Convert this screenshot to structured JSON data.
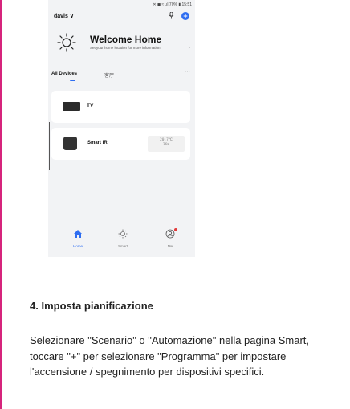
{
  "statusbar": {
    "indicators": "✕ ◼ ≈ .ıl 70% ▮ 15:51"
  },
  "topbar": {
    "home_name": "davis ∨",
    "mic_icon": "microphone-icon",
    "add_icon": "+"
  },
  "welcome": {
    "title": "Welcome Home",
    "subtitle": "Set your home location for more information",
    "chevron": "›"
  },
  "tabs": {
    "all_devices": "All Devices",
    "room": "客厅",
    "more": "···"
  },
  "devices": [
    {
      "name": "TV",
      "icon": "tv-icon"
    },
    {
      "name": "Smart IR",
      "icon": "ir-icon",
      "temperature": "20.7℃",
      "humidity": "36%"
    }
  ],
  "bottom_nav": {
    "home": "Home",
    "smart": "Smart",
    "me": "Me"
  },
  "colors": {
    "accent": "#2f6ef1",
    "page_border": "#d6247c"
  },
  "section": {
    "title": "4. Imposta pianificazione",
    "body": "Selezionare \"Scenario\" o \"Automazione\" nella pagina Smart, toccare \"+\" per selezionare \"Programma\" per impostare l'accensione / spegnimento per dispositivi specifici."
  }
}
